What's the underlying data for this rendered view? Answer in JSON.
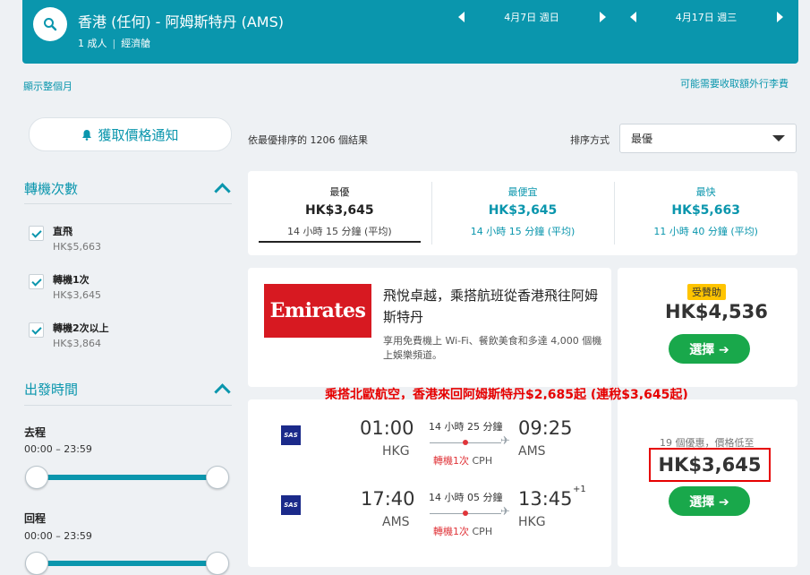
{
  "header": {
    "route": "香港 (任何) - 阿姆斯特丹 (AMS)",
    "passengers": "1 成人",
    "cabin": "經濟艙",
    "depart_date": "4月7日 週日",
    "return_date": "4月17日 週三"
  },
  "links": {
    "show_month": "顯示整個月",
    "extra_fees": "可能需要收取額外行李費"
  },
  "sidebar": {
    "price_alert": "獲取價格通知",
    "stops_title": "轉機次數",
    "stops": [
      {
        "label": "直飛",
        "price": "HK$5,663",
        "checked": true
      },
      {
        "label": "轉機1次",
        "price": "HK$3,645",
        "checked": true
      },
      {
        "label": "轉機2次以上",
        "price": "HK$3,864",
        "checked": true
      }
    ],
    "times_title": "出發時間",
    "outbound_label": "去程",
    "outbound_range": "00:00 – 23:59",
    "return_label": "回程",
    "return_range": "00:00 – 23:59"
  },
  "results": {
    "summary": "依最優排序的 1206 個結果",
    "sort_label": "排序方式",
    "sort_value": "最優"
  },
  "tabs": [
    {
      "title": "最優",
      "price": "HK$3,645",
      "duration": "14 小時 15 分鐘 (平均)"
    },
    {
      "title": "最便宜",
      "price": "HK$3,645",
      "duration": "14 小時 15 分鐘 (平均)"
    },
    {
      "title": "最快",
      "price": "HK$5,663",
      "duration": "11 小時 40 分鐘 (平均)"
    }
  ],
  "ad": {
    "logo_text": "Emirates",
    "headline": "飛悅卓越，乘搭航班從香港飛往阿姆斯特丹",
    "body": "享用免費機上 Wi-Fi、餐飲美食和多達 4,000 個機上娛樂頻道。",
    "badge": "受贊助",
    "price": "HK$4,536",
    "button": "選擇 ➔"
  },
  "promo": "乘搭北歐航空，香港來回阿姆斯特丹$2,685起 (連稅$3,645起)",
  "flight": {
    "airline_logo": "SAS",
    "legs": [
      {
        "depart_time": "01:00",
        "depart_airport": "HKG",
        "duration": "14 小時 25 分鐘",
        "arrive_time": "09:25",
        "arrive_airport": "AMS",
        "stops_label": "轉機1次",
        "via": "CPH",
        "plus_day": ""
      },
      {
        "depart_time": "17:40",
        "depart_airport": "AMS",
        "duration": "14 小時 05 分鐘",
        "arrive_time": "13:45",
        "arrive_airport": "HKG",
        "stops_label": "轉機1次",
        "via": "CPH",
        "plus_day": "+1"
      }
    ],
    "deals_text": "19 個優惠，價格低至",
    "price": "HK$3,645",
    "button": "選擇 ➔"
  },
  "colors": {
    "brand": "#0a96ad",
    "select_green": "#19a84b",
    "emirates_red": "#d71921",
    "promo_red": "#e60000",
    "sponsored": "#ffc400"
  }
}
